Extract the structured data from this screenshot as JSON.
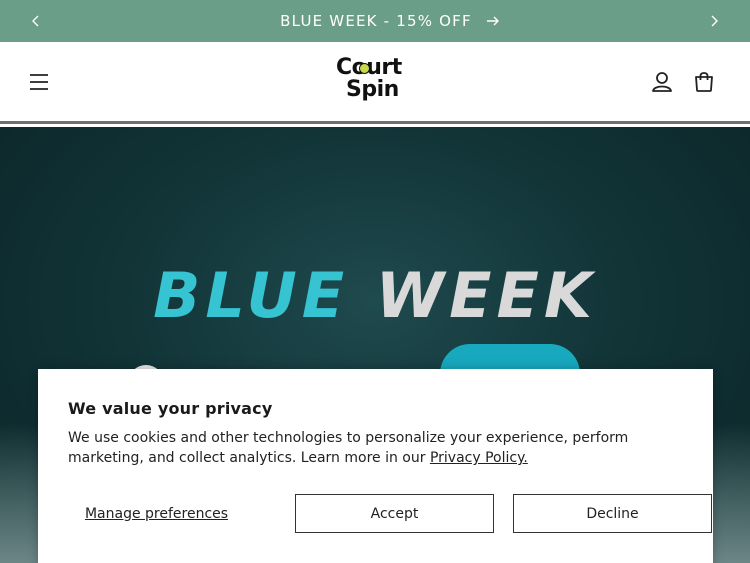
{
  "announcement": {
    "text": "BLUE WEEK - 15% OFF",
    "prev_icon": "chevron-left-icon",
    "next_icon": "chevron-right-icon",
    "link_icon": "arrow-right-icon",
    "background": "#6a9e88"
  },
  "header": {
    "logo_line1": "Court",
    "logo_line2": "Spin",
    "menu_icon": "hamburger-menu-icon",
    "account_icon": "user-icon",
    "cart_icon": "shopping-bag-icon"
  },
  "hero": {
    "title_word1": "BLUE",
    "title_word2": "WEEK",
    "accent": "#36c3d2"
  },
  "cookie_banner": {
    "title": "We value your privacy",
    "body": "We use cookies and other technologies to personalize your experience, perform marketing, and collect analytics. Learn more in our ",
    "policy_link": "Privacy Policy.",
    "manage_label": "Manage preferences",
    "accept_label": "Accept",
    "decline_label": "Decline"
  }
}
